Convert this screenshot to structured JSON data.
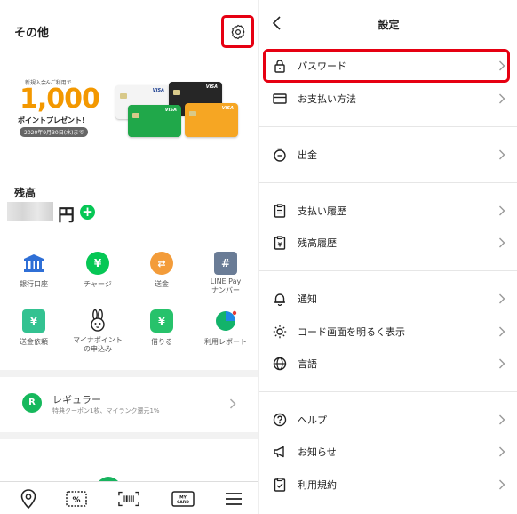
{
  "left": {
    "title": "その他",
    "banner": {
      "small_text": "新規入会&ご利用で",
      "amount": "1,000",
      "present": "ポイントプレゼント!",
      "date": "2020年9月30日(水)まで",
      "card_brand": "VISA"
    },
    "balance_label": "残高",
    "balance_unit": "円",
    "grid": [
      {
        "label": "銀行口座",
        "icon": "bank-icon"
      },
      {
        "label": "チャージ",
        "icon": "charge-icon"
      },
      {
        "label": "送金",
        "icon": "send-icon"
      },
      {
        "label": "LINE Pay\nナンバー",
        "icon": "number-icon"
      },
      {
        "label": "送金依頼",
        "icon": "request-icon"
      },
      {
        "label": "マイナポイント\nの申込み",
        "icon": "mynapoint-icon"
      },
      {
        "label": "借りる",
        "icon": "borrow-icon"
      },
      {
        "label": "利用レポート",
        "icon": "report-icon"
      }
    ],
    "regular": {
      "badge": "R",
      "title": "レギュラー",
      "subtitle": "特典クーポン1枚、マイランク還元1%"
    },
    "bottom_nav": [
      "location-icon",
      "coupon-icon",
      "barcode-icon",
      "mycard-icon",
      "menu-icon"
    ],
    "mycard_label": "MY CARD"
  },
  "right": {
    "title": "設定",
    "rows": [
      {
        "label": "パスワード",
        "icon": "lock-icon"
      },
      {
        "label": "お支払い方法",
        "icon": "card-icon"
      },
      {
        "label": "出金",
        "icon": "withdraw-icon"
      },
      {
        "label": "支払い履歴",
        "icon": "payment-history-icon"
      },
      {
        "label": "残高履歴",
        "icon": "balance-history-icon"
      },
      {
        "label": "通知",
        "icon": "bell-icon"
      },
      {
        "label": "コード画面を明るく表示",
        "icon": "brightness-icon"
      },
      {
        "label": "言語",
        "icon": "globe-icon"
      },
      {
        "label": "ヘルプ",
        "icon": "help-icon"
      },
      {
        "label": "お知らせ",
        "icon": "megaphone-icon"
      },
      {
        "label": "利用規約",
        "icon": "terms-icon"
      }
    ]
  },
  "colors": {
    "line_green": "#06c755",
    "highlight_red": "#e60012",
    "banner_orange": "#f39800"
  }
}
